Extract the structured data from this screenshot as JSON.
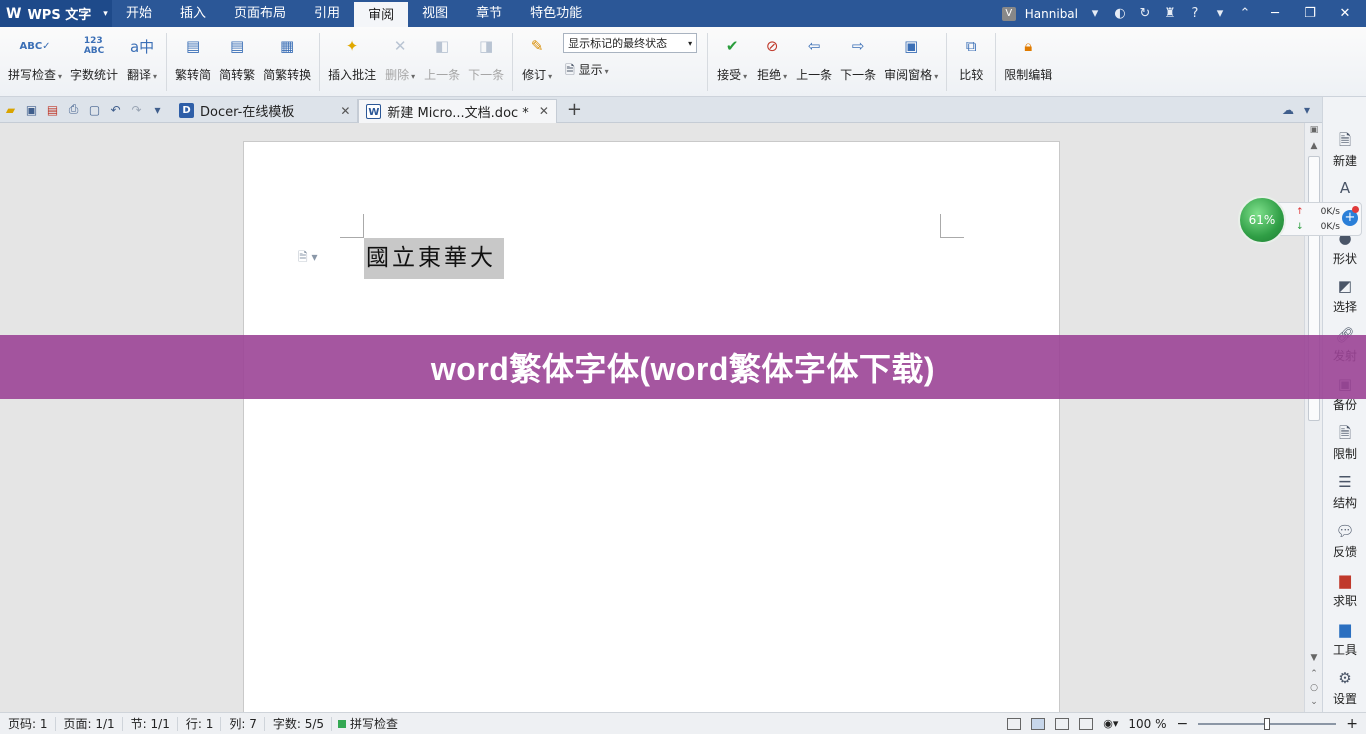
{
  "app": {
    "name": "WPS 文字",
    "logo_glyph": "W"
  },
  "menu": {
    "tabs": [
      {
        "label": "开始"
      },
      {
        "label": "插入"
      },
      {
        "label": "页面布局"
      },
      {
        "label": "引用"
      },
      {
        "label": "审阅",
        "active": true
      },
      {
        "label": "视图"
      },
      {
        "label": "章节"
      },
      {
        "label": "特色功能"
      }
    ],
    "user": "Hannibal",
    "user_avatar": "V",
    "help": "?"
  },
  "ribbon": {
    "spell_check": "拼写检查",
    "word_count": "字数统计",
    "translate": "翻译",
    "trad_to_simp": "繁转简",
    "simp_to_trad": "简转繁",
    "convert": "简繁转换",
    "insert_comment": "插入批注",
    "delete": "删除",
    "prev_comment": "上一条",
    "next_comment": "下一条",
    "track_changes": "修订",
    "display": "显示",
    "markup_state": "显示标记的最终状态",
    "accept": "接受",
    "reject": "拒绝",
    "prev_change": "上一条",
    "next_change": "下一条",
    "review_pane": "审阅窗格",
    "compare": "比较",
    "restrict_editing": "限制编辑"
  },
  "tabs": [
    {
      "label": "Docer-在线模板",
      "icon": "D"
    },
    {
      "label": "新建 Micro...文档.doc *",
      "icon": "W",
      "active": true
    }
  ],
  "document": {
    "text": "國立東華大"
  },
  "sidebar": {
    "items": [
      {
        "label": "新建"
      },
      {
        "label": "样式"
      },
      {
        "label": "形状"
      },
      {
        "label": "选择"
      },
      {
        "label": "发射"
      },
      {
        "label": "备份"
      },
      {
        "label": "限制"
      },
      {
        "label": "结构"
      },
      {
        "label": "反馈"
      },
      {
        "label": "求职"
      },
      {
        "label": "工具"
      },
      {
        "label": "设置"
      }
    ]
  },
  "network": {
    "percent": "61%",
    "upload": "0K/s",
    "download": "0K/s"
  },
  "banner": {
    "text": "word繁体字体(word繁体字体下载)"
  },
  "status": {
    "page": "页码: 1",
    "pages": "页面: 1/1",
    "section": "节: 1/1",
    "row": "行: 1",
    "column": "列: 7",
    "chars": "字数: 5/5",
    "spell": "拼写检查",
    "zoom": "100 %",
    "zoom_level_fraction": 0.5
  },
  "colors": {
    "title_bar": "#2b5797",
    "banner": "#9b4496",
    "accent": "#2b6fc0"
  }
}
